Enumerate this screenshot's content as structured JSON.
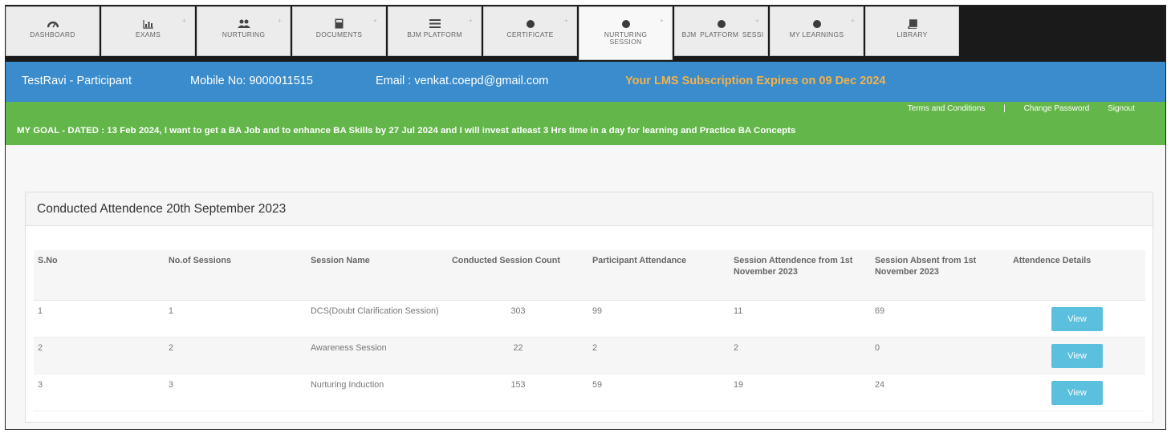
{
  "nav": {
    "tabs": [
      {
        "label": "DASHBOARD",
        "icon": "dashboard-icon"
      },
      {
        "label": "EXAMS",
        "icon": "chart-icon"
      },
      {
        "label": "NURTURING",
        "icon": "users-icon"
      },
      {
        "label": "DOCUMENTS",
        "icon": "document-icon"
      },
      {
        "label": "BJM PLATFORM",
        "icon": "list-icon"
      },
      {
        "label": "CERTIFICATE",
        "icon": "dot-icon"
      },
      {
        "label": "NURTURING SESSION",
        "icon": "dot-icon"
      },
      {
        "label": "BJM PLATFORM SESSI",
        "icon": "dot-icon"
      },
      {
        "label": "MY LEARNINGS",
        "icon": "dot-icon"
      },
      {
        "label": "LIBRARY",
        "icon": "book-icon"
      }
    ],
    "active_index": 6
  },
  "user": {
    "name_role": "TestRavi - Participant",
    "mobile": "Mobile No: 9000011515",
    "email": "Email : venkat.coepd@gmail.com",
    "subscription": "Your LMS Subscription Expires on 09 Dec 2024"
  },
  "links": {
    "terms": "Terms and Conditions",
    "separator": "|",
    "change_password": "Change Password",
    "signout": "Signout"
  },
  "goal": "MY GOAL - DATED : 13 Feb 2024, I want to get a BA Job and to enhance BA Skills by 27 Jul 2024 and I will invest atleast 3 Hrs time in a day for learning and Practice BA Concepts",
  "panel": {
    "title": "Conducted Attendence 20th September 2023",
    "columns": [
      "S.No",
      "No.of Sessions",
      "Session Name",
      "Conducted Session Count",
      "Participant Attendance",
      "Session Attendence from 1st November 2023",
      "Session Absent from 1st November 2023",
      "Attendence Details"
    ],
    "rows": [
      {
        "sno": "1",
        "sessions": "1",
        "name": "DCS(Doubt Clarification Session)",
        "conducted": "303",
        "participant": "99",
        "attended": "11",
        "absent": "69",
        "action": "View"
      },
      {
        "sno": "2",
        "sessions": "2",
        "name": "Awareness Session",
        "conducted": "22",
        "participant": "2",
        "attended": "2",
        "absent": "0",
        "action": "View"
      },
      {
        "sno": "3",
        "sessions": "3",
        "name": "Nurturing Induction",
        "conducted": "153",
        "participant": "59",
        "attended": "19",
        "absent": "24",
        "action": "View"
      }
    ]
  },
  "colors": {
    "nav_bg": "#1a1a1a",
    "blue_bar": "#3a8ccc",
    "green_bar": "#63b64a",
    "expiry_text": "#f4b24a",
    "view_button": "#5bc0de"
  }
}
